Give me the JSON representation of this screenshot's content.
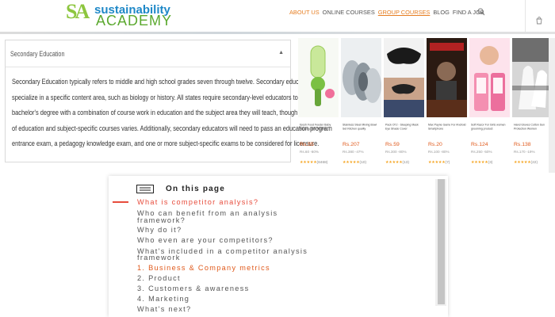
{
  "header": {
    "logo": {
      "mark": "SA",
      "line1": "sustainability",
      "line2": "ACADEMY"
    },
    "nav": [
      {
        "label": "ABOUT US",
        "state": "active"
      },
      {
        "label": "ONLINE COURSES",
        "state": "normal"
      },
      {
        "label": "GROUP COURSES",
        "state": "underline"
      },
      {
        "label": "BLOG",
        "state": "normal"
      },
      {
        "label": "FIND A JOB",
        "state": "normal"
      }
    ],
    "icons": [
      "search-icon",
      "cart-icon"
    ],
    "accent_color": "#e67e22"
  },
  "accordion": {
    "title": "Secondary Education",
    "caret": "▲",
    "expanded": true,
    "body_lines": [
      "Secondary Education typically refers to middle and high school grades seven through twelve. Secondary educators usually",
      "specialize in a specific content area, such as biology or history. All states require secondary-level educators to earn a",
      "bachelor's degree with a combination of course work in education and the subject area they will teach, though the number",
      "of education and subject-specific courses varies. Additionally, secondary educators will need to pass an education program",
      "entrance exam, a pedagogy knowledge exam, and one or more subject-specific exams to be considered for licensure."
    ]
  },
  "products": [
    {
      "name": "Fresh Food Feeder Baby Feeding Safe Pacifier",
      "price": "Rs.55",
      "discount": "Rs.60 -60%",
      "stars": "★★★★★",
      "count": "(8468)"
    },
    {
      "name": "Stainless Steel Mixing Bowl Set Kitchen quality",
      "price": "Rs.207",
      "discount": "Rs.380 -47%",
      "stars": "★★★★★",
      "count": "(10)"
    },
    {
      "name": "Pack Of 2 - Sleeping Mask Eye Shade Cover",
      "price": "Rs.59",
      "discount": "Rs.300 -80%",
      "stars": "★★★★★",
      "count": "(13)"
    },
    {
      "name": "Max Payne Game For Android Smartphone",
      "price": "Rs.20",
      "discount": "Rs.100 -80%",
      "stars": "★★★★★",
      "count": "(7)"
    },
    {
      "name": "Soft Razor For Girls women grooming product",
      "price": "Rs.124",
      "discount": "Rs.250 -50%",
      "stars": "★★★★★",
      "count": "(3)"
    },
    {
      "name": "Hand Gloves Cotton Sun Protection Women",
      "price": "Rs.138",
      "discount": "Rs.170 -19%",
      "stars": "★★★★★",
      "count": "(22)"
    }
  ],
  "on_this_page": {
    "heading": "On this page",
    "items": [
      {
        "label": "What is competitor analysis?",
        "kind": "active"
      },
      {
        "label": "Who can benefit from an analysis",
        "label2": "framework?",
        "kind": "normal"
      },
      {
        "label": "Why do it?",
        "kind": "normal"
      },
      {
        "label": "Who even are your competitors?",
        "kind": "normal"
      },
      {
        "label": "What's included in a competitor analysis",
        "label2": "framework",
        "kind": "normal"
      },
      {
        "label": "1. Business & Company metrics",
        "kind": "sub"
      },
      {
        "label": "2. Product",
        "kind": "normal"
      },
      {
        "label": "3. Customers & awareness",
        "kind": "normal"
      },
      {
        "label": "4. Marketing",
        "kind": "normal"
      },
      {
        "label": "What's next?",
        "kind": "normal"
      }
    ],
    "active_color": "#e74c3c"
  }
}
